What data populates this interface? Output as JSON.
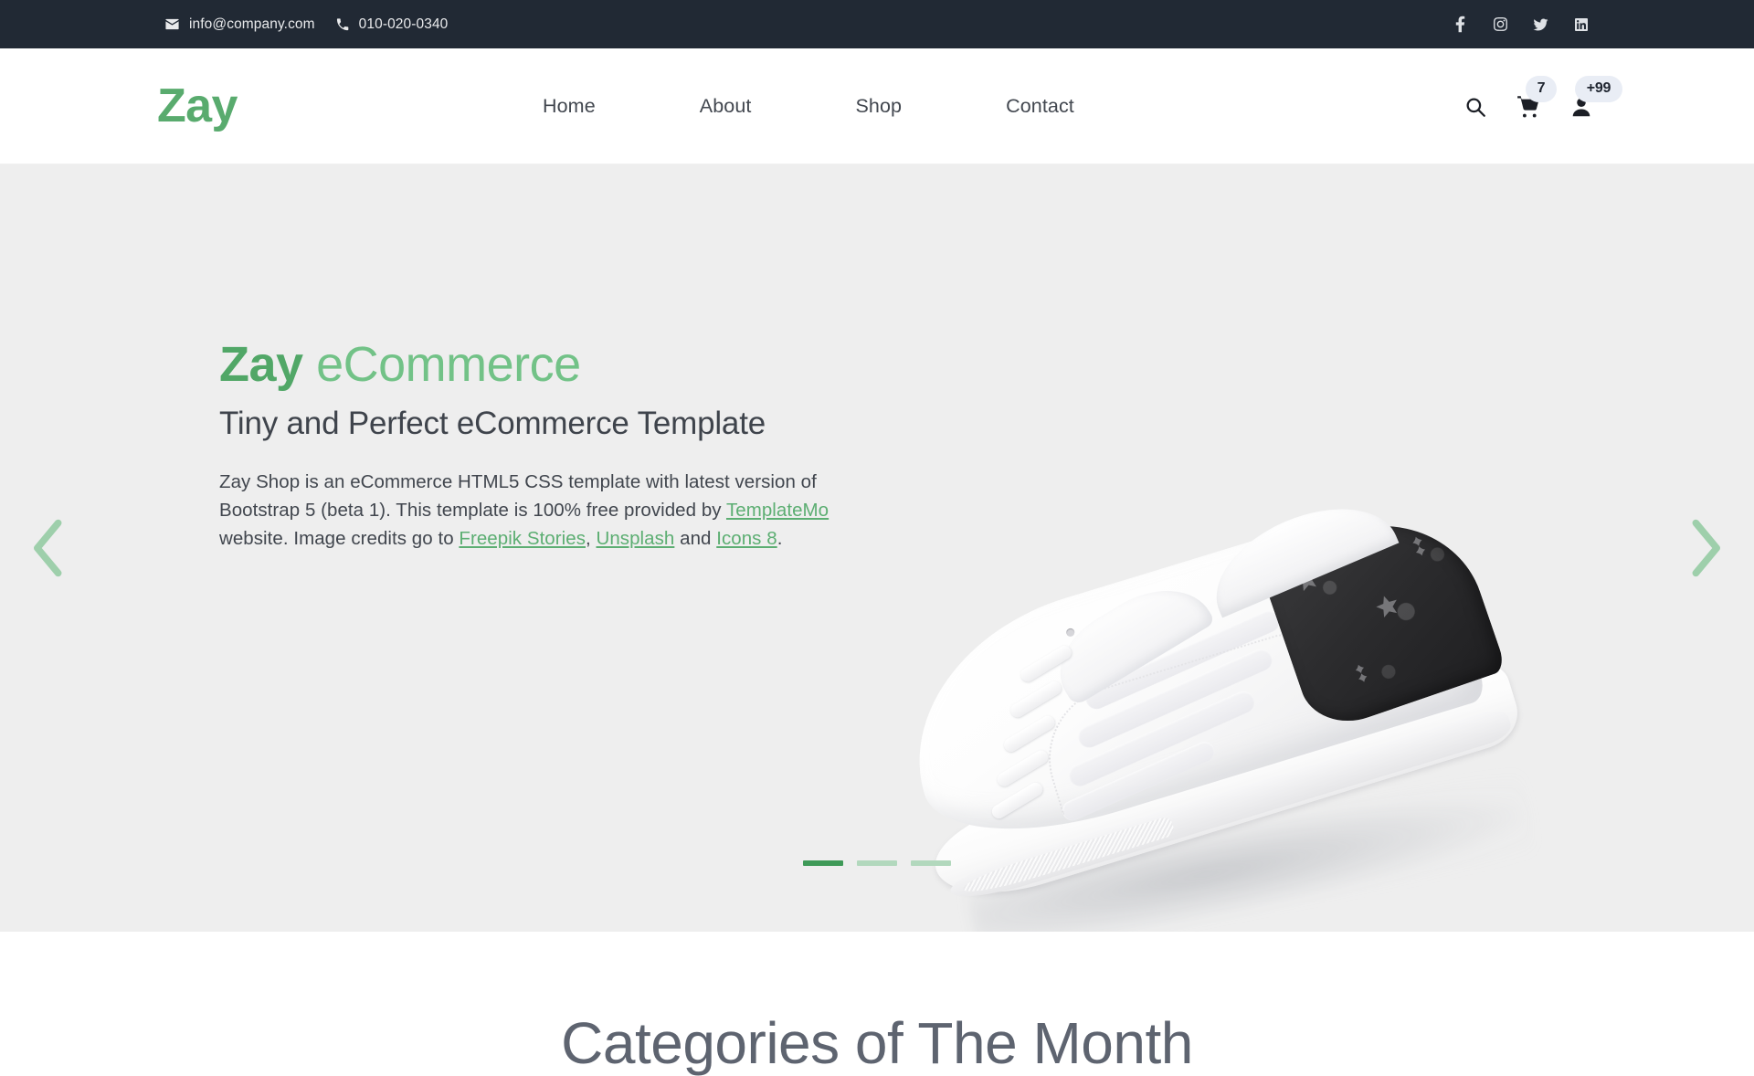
{
  "topbar": {
    "email": "info@company.com",
    "phone": "010-020-0340",
    "email_icon": "envelope-icon",
    "phone_icon": "phone-icon",
    "socials": [
      {
        "name": "facebook-icon",
        "label": "Facebook"
      },
      {
        "name": "instagram-icon",
        "label": "Instagram"
      },
      {
        "name": "twitter-icon",
        "label": "Twitter"
      },
      {
        "name": "linkedin-icon",
        "label": "LinkedIn"
      }
    ],
    "background_color": "#212934",
    "text_color": "#e9eaec"
  },
  "navbar": {
    "logo": "Zay",
    "logo_color": "#59ab6e",
    "links": [
      {
        "label": "Home"
      },
      {
        "label": "About"
      },
      {
        "label": "Shop"
      },
      {
        "label": "Contact"
      }
    ],
    "icons": {
      "search": "search-icon",
      "cart": "shopping-cart-icon",
      "user": "user-icon"
    },
    "cart_badge": "7",
    "user_badge": "+99",
    "badge_bg": "#e9edf5"
  },
  "hero": {
    "background_color": "#eeeeee",
    "title_strong": "Zay",
    "title_rest": " eCommerce",
    "title_color": "#72c287",
    "title_strong_color": "#51a767",
    "subtitle": "Tiny and Perfect eCommerce Template",
    "paragraph": {
      "p1": "Zay Shop is an eCommerce HTML5 CSS template with latest version of Bootstrap 5 (beta 1). This template is 100% free provided by ",
      "link1": "TemplateMo",
      "p2": " website. Image credits go to ",
      "link2": "Freepik Stories",
      "p3": ", ",
      "link3": "Unsplash",
      "p4": " and ",
      "link4": "Icons 8",
      "p5": "."
    },
    "link_color": "#5cae72",
    "prev_arrow": "chevron-left-icon",
    "next_arrow": "chevron-right-icon",
    "arrow_color": "#9ecfab",
    "product_image_alt": "white-sneaker-with-dark-monogram-heel",
    "indicators": [
      {
        "active": true
      },
      {
        "active": false
      },
      {
        "active": false
      }
    ],
    "indicator_active_color": "#3f9a58",
    "indicator_color": "#b2d8bd"
  },
  "categories_section": {
    "title": "Categories of The Month",
    "title_color": "#5e6470"
  }
}
